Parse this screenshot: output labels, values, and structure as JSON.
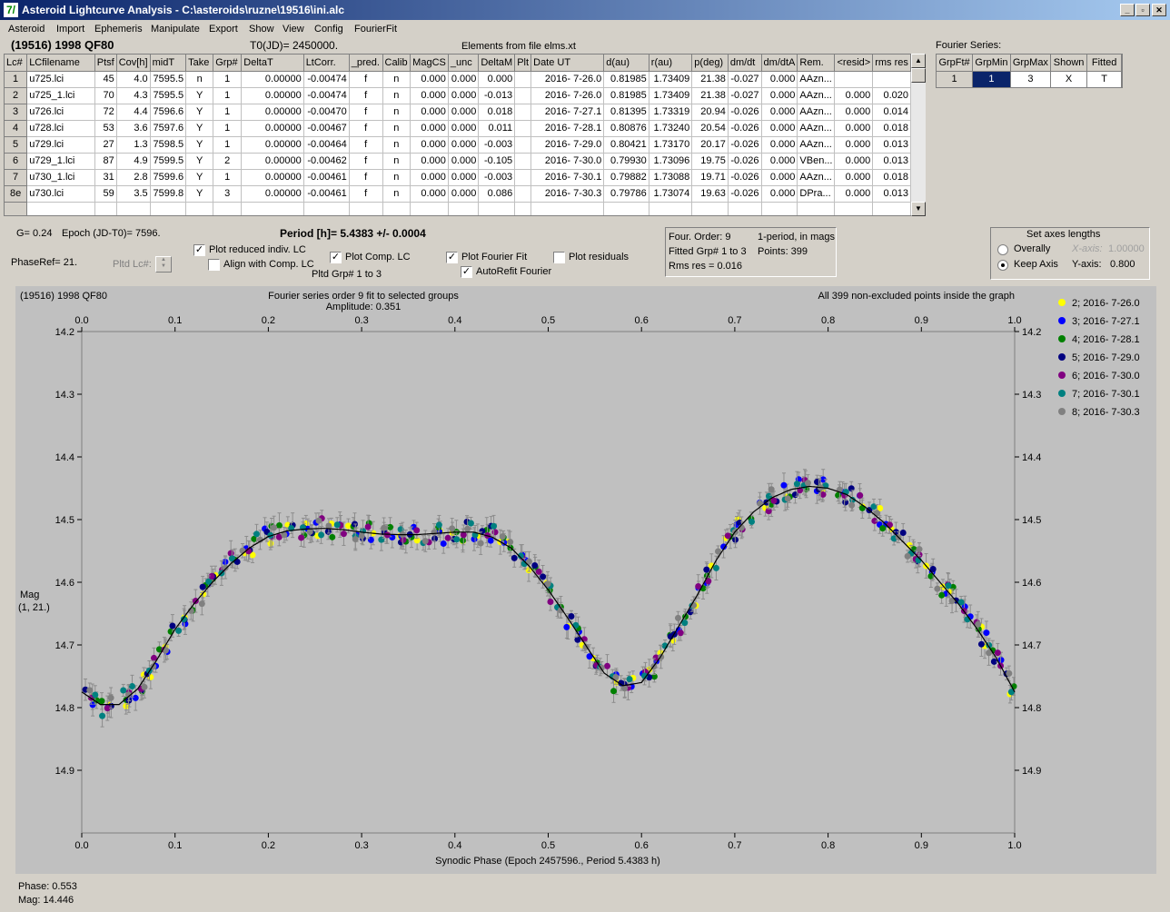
{
  "window": {
    "title": "Asteroid Lightcurve Analysis - C:\\asteroids\\ruzne\\19516\\ini.alc",
    "app_icon": "7/",
    "min_icon": "_",
    "restore_icon": "▫",
    "close_icon": "✕"
  },
  "menu": [
    "Asteroid",
    "Import",
    "Ephemeris",
    "Manipulate",
    "Export",
    "Show",
    "View",
    "Config",
    "FourierFit"
  ],
  "header": {
    "asteroid": "(19516) 1998 QF80",
    "t0": "T0(JD)= 2450000.",
    "elements": "Elements from file elms.xt"
  },
  "table": {
    "columns": [
      "Lc#",
      "LCfilename",
      "Ptsf",
      "Cov[h]",
      "midT",
      "Take",
      "Grp#",
      "DeltaT",
      "LtCorr.",
      "_pred.",
      "Calib",
      "MagCS",
      "_unc",
      "DeltaM",
      "Plt",
      "Date UT",
      "d(au)",
      "r(au)",
      "p(deg)",
      "dm/dt",
      "dm/dtA",
      "Rem.",
      "<resid>",
      "rms res"
    ],
    "rows": [
      [
        "1",
        "u725.lci",
        "45",
        "4.0",
        "7595.5",
        "n",
        "1",
        "0.00000",
        "-0.00474",
        "f",
        "n",
        "0.000",
        "0.000",
        "0.000",
        "",
        "2016- 7-26.0",
        "0.81985",
        "1.73409",
        "21.38",
        "-0.027",
        "0.000",
        "AAzn...",
        "",
        ""
      ],
      [
        "2",
        "u725_1.lci",
        "70",
        "4.3",
        "7595.5",
        "Y",
        "1",
        "0.00000",
        "-0.00474",
        "f",
        "n",
        "0.000",
        "0.000",
        "-0.013",
        "",
        "2016- 7-26.0",
        "0.81985",
        "1.73409",
        "21.38",
        "-0.027",
        "0.000",
        "AAzn...",
        "0.000",
        "0.020"
      ],
      [
        "3",
        "u726.lci",
        "72",
        "4.4",
        "7596.6",
        "Y",
        "1",
        "0.00000",
        "-0.00470",
        "f",
        "n",
        "0.000",
        "0.000",
        "0.018",
        "",
        "2016- 7-27.1",
        "0.81395",
        "1.73319",
        "20.94",
        "-0.026",
        "0.000",
        "AAzn...",
        "0.000",
        "0.014"
      ],
      [
        "4",
        "u728.lci",
        "53",
        "3.6",
        "7597.6",
        "Y",
        "1",
        "0.00000",
        "-0.00467",
        "f",
        "n",
        "0.000",
        "0.000",
        "0.011",
        "",
        "2016- 7-28.1",
        "0.80876",
        "1.73240",
        "20.54",
        "-0.026",
        "0.000",
        "AAzn...",
        "0.000",
        "0.018"
      ],
      [
        "5",
        "u729.lci",
        "27",
        "1.3",
        "7598.5",
        "Y",
        "1",
        "0.00000",
        "-0.00464",
        "f",
        "n",
        "0.000",
        "0.000",
        "-0.003",
        "",
        "2016- 7-29.0",
        "0.80421",
        "1.73170",
        "20.17",
        "-0.026",
        "0.000",
        "AAzn...",
        "0.000",
        "0.013"
      ],
      [
        "6",
        "u729_1.lci",
        "87",
        "4.9",
        "7599.5",
        "Y",
        "2",
        "0.00000",
        "-0.00462",
        "f",
        "n",
        "0.000",
        "0.000",
        "-0.105",
        "",
        "2016- 7-30.0",
        "0.79930",
        "1.73096",
        "19.75",
        "-0.026",
        "0.000",
        "VBen...",
        "0.000",
        "0.013"
      ],
      [
        "7",
        "u730_1.lci",
        "31",
        "2.8",
        "7599.6",
        "Y",
        "1",
        "0.00000",
        "-0.00461",
        "f",
        "n",
        "0.000",
        "0.000",
        "-0.003",
        "",
        "2016- 7-30.1",
        "0.79882",
        "1.73088",
        "19.71",
        "-0.026",
        "0.000",
        "AAzn...",
        "0.000",
        "0.018"
      ],
      [
        "8e",
        "u730.lci",
        "59",
        "3.5",
        "7599.8",
        "Y",
        "3",
        "0.00000",
        "-0.00461",
        "f",
        "n",
        "0.000",
        "0.000",
        "0.086",
        "",
        "2016- 7-30.3",
        "0.79786",
        "1.73074",
        "19.63",
        "-0.026",
        "0.000",
        "DPra...",
        "0.000",
        "0.013"
      ]
    ]
  },
  "fourier_series": {
    "label": "Fourier Series:",
    "columns": [
      "GrpFt#",
      "GrpMin",
      "GrpMax",
      "Shown",
      "Fitted"
    ],
    "row": [
      "1",
      "1",
      "3",
      "X",
      "T"
    ]
  },
  "params": {
    "g": "G= 0.24",
    "epoch": "Epoch (JD-T0)= 7596.",
    "period": "Period [h]= 5.4383 +/- 0.0004",
    "phase_ref": "PhaseRef= 21.",
    "pltd_lc": "Pltd Lc#:",
    "plot_reduced": "Plot reduced indiv. LC",
    "align_comp": "Align with Comp. LC",
    "plot_comp": "Plot Comp. LC",
    "pltd_grp": "Pltd Grp#  1   to   3",
    "plot_fourier": "Plot Fourier Fit",
    "autorefit": "AutoRefit Fourier",
    "plot_residuals": "Plot residuals",
    "check_mark": "✓"
  },
  "fit_info": {
    "order": "Four. Order:  9",
    "one_period": "1-period, in mags",
    "fitted_grp": "Fitted Grp# 1 to 3",
    "points": "Points: 399",
    "rms": "Rms res     = 0.016"
  },
  "axes_box": {
    "title": "Set axes lengths",
    "overally": "Overally",
    "keep_axis": "Keep Axis",
    "x_axis_label": "X-axis:",
    "x_axis_value": "1.00000",
    "y_axis_label": "Y-axis:",
    "y_axis_value": "0.800"
  },
  "status": {
    "phase": "Phase:  0.553",
    "mag": "Mag:     14.446"
  },
  "chart_data": {
    "type": "scatter",
    "title": "Fourier series order 9 fit to selected groups",
    "subtitle": "Amplitude: 0.351",
    "corner_left": "(19516) 1998 QF80",
    "corner_right": "All 399 non-excluded points inside the graph",
    "xlabel": "Synodic Phase (Epoch 2457596., Period 5.4383 h)",
    "ylabel": "Mag",
    "ylabel2": "(1, 21.)",
    "xlim": [
      0,
      1
    ],
    "ylim": [
      14.2,
      15.0
    ],
    "y_inverted": true,
    "xticks": [
      0.0,
      0.1,
      0.2,
      0.3,
      0.4,
      0.5,
      0.6,
      0.7,
      0.8,
      0.9,
      1.0
    ],
    "yticks": [
      14.2,
      14.3,
      14.4,
      14.5,
      14.6,
      14.7,
      14.8,
      14.9
    ],
    "fit_curve": {
      "x": [
        0.0,
        0.02,
        0.04,
        0.06,
        0.08,
        0.1,
        0.12,
        0.14,
        0.16,
        0.18,
        0.2,
        0.22,
        0.24,
        0.26,
        0.28,
        0.3,
        0.32,
        0.34,
        0.36,
        0.38,
        0.4,
        0.42,
        0.44,
        0.46,
        0.48,
        0.5,
        0.52,
        0.54,
        0.56,
        0.58,
        0.6,
        0.62,
        0.64,
        0.66,
        0.68,
        0.7,
        0.72,
        0.74,
        0.76,
        0.78,
        0.8,
        0.82,
        0.84,
        0.86,
        0.88,
        0.9,
        0.92,
        0.94,
        0.96,
        0.98,
        1.0
      ],
      "y": [
        14.775,
        14.795,
        14.795,
        14.77,
        14.725,
        14.675,
        14.635,
        14.6,
        14.57,
        14.545,
        14.527,
        14.518,
        14.515,
        14.514,
        14.516,
        14.52,
        14.523,
        14.524,
        14.524,
        14.522,
        14.52,
        14.52,
        14.528,
        14.545,
        14.575,
        14.612,
        14.655,
        14.7,
        14.745,
        14.765,
        14.76,
        14.72,
        14.67,
        14.62,
        14.565,
        14.52,
        14.488,
        14.465,
        14.452,
        14.447,
        14.45,
        14.46,
        14.48,
        14.505,
        14.535,
        14.565,
        14.6,
        14.635,
        14.675,
        14.72,
        14.775
      ]
    },
    "series": [
      {
        "name": "2; 2016- 7-26.0",
        "color": "#ffff00"
      },
      {
        "name": "3; 2016- 7-27.1",
        "color": "#0000ff"
      },
      {
        "name": "4; 2016- 7-28.1",
        "color": "#008000"
      },
      {
        "name": "5; 2016- 7-29.0",
        "color": "#000080"
      },
      {
        "name": "6; 2016- 7-30.0",
        "color": "#800080"
      },
      {
        "name": "7; 2016- 7-30.1",
        "color": "#008080"
      },
      {
        "name": "8; 2016- 7-30.3",
        "color": "#808080"
      }
    ],
    "points_per_series": 57
  }
}
